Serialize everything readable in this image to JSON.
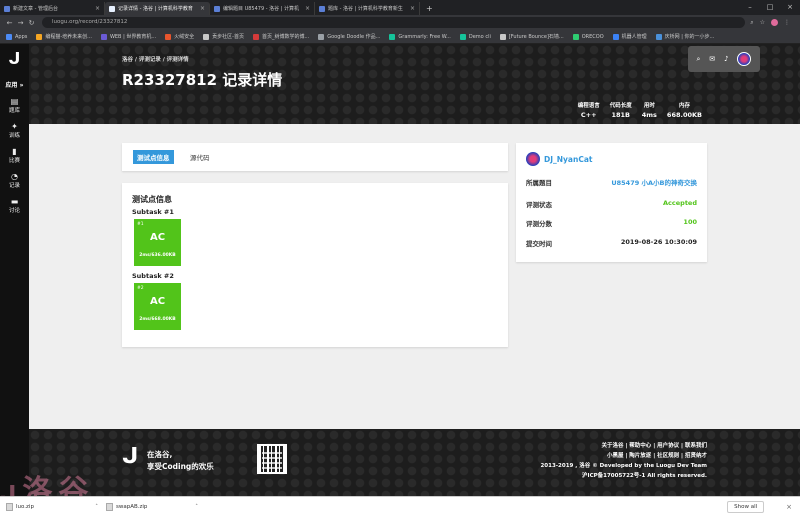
{
  "browser": {
    "tabs": [
      {
        "title": "新建文章 - 管理后台",
        "active": false
      },
      {
        "title": "记录详情 - 洛谷 | 计算机科学教育",
        "active": true
      },
      {
        "title": "编辑题目 U85479 - 洛谷 | 计算机",
        "active": false
      },
      {
        "title": "题库 - 洛谷 | 计算机科学教育新生",
        "active": false
      }
    ],
    "url": "luogu.org/record/23327812",
    "bookmarks": [
      {
        "label": "Apps",
        "color": "#4c8bf5"
      },
      {
        "label": "编程猫-培养未来创...",
        "color": "#f5a623"
      },
      {
        "label": "WEB | 世界教育机...",
        "color": "#6b5bd6"
      },
      {
        "label": "火绒安全",
        "color": "#e8552d"
      },
      {
        "label": "贡步社区-首页",
        "color": "#c8c8c8"
      },
      {
        "label": "首页_树博数学的博...",
        "color": "#d43a3a"
      },
      {
        "label": "Google Doodle 作品...",
        "color": "#9aa0a6"
      },
      {
        "label": "Grammarly: Free W...",
        "color": "#15c39a"
      },
      {
        "label": "Demo cli",
        "color": "#15c39a"
      },
      {
        "label": "[Future Bounce]石墙...",
        "color": "#c8c8c8"
      },
      {
        "label": "ORECOO",
        "color": "#2ecc71"
      },
      {
        "label": "机器人管理",
        "color": "#3b82f6"
      },
      {
        "label": "庆桥网 | 你的一小步...",
        "color": "#4a90d9"
      }
    ]
  },
  "sidebar": {
    "apps_label": "应用 »",
    "items": [
      {
        "label": "题库",
        "icon": "▤"
      },
      {
        "label": "训练",
        "icon": "✦"
      },
      {
        "label": "比赛",
        "icon": "▮"
      },
      {
        "label": "记录",
        "icon": "◔"
      },
      {
        "label": "讨论",
        "icon": "▬"
      }
    ]
  },
  "header": {
    "breadcrumb": "洛谷 / 评测记录 / 评测详情",
    "title": "R23327812 记录详情",
    "stats": [
      {
        "label": "编程语言",
        "value": "C++"
      },
      {
        "label": "代码长度",
        "value": "181B"
      },
      {
        "label": "用时",
        "value": "4ms"
      },
      {
        "label": "内存",
        "value": "668.00KB"
      }
    ]
  },
  "tabs": {
    "active": "测试点信息",
    "other": "源代码"
  },
  "tests": {
    "title": "测试点信息",
    "subtasks": [
      {
        "name": "Subtask #1",
        "case": "#1",
        "status": "AC",
        "info": "2ms/636.00KB"
      },
      {
        "name": "Subtask #2",
        "case": "#2",
        "status": "AC",
        "info": "2ms/668.00KB"
      }
    ],
    "ac_color": "#52c41a"
  },
  "info": {
    "user": "DJ_NyanCat",
    "rows": [
      {
        "label": "所属题目",
        "value": "U85479 小A小B的神奇交换",
        "color": "blue"
      },
      {
        "label": "评测状态",
        "value": "Accepted",
        "color": "green"
      },
      {
        "label": "评测分数",
        "value": "100",
        "color": "green"
      },
      {
        "label": "提交时间",
        "value": "2019-08-26 10:30:09",
        "color": "dark"
      }
    ]
  },
  "footer": {
    "logo": "ᒍ",
    "slogan_line1": "在洛谷,",
    "slogan_line2": "享受Coding的欢乐",
    "links_line1": "关于洛谷 | 帮助中心 | 用户协议 | 联系我们",
    "links_line2": "小黑屋 | 陶片放逐 | 社区规则 | 招贤纳才",
    "copyright": "2013-2019 , 洛谷 © Developed by the Luogu Dev Team",
    "icp": "沪ICP备17005722号-1 All rights reserved."
  },
  "watermark": "洛谷",
  "downloads": {
    "items": [
      "luo.zip",
      "swapAB.zip"
    ],
    "show_all": "Show all"
  }
}
